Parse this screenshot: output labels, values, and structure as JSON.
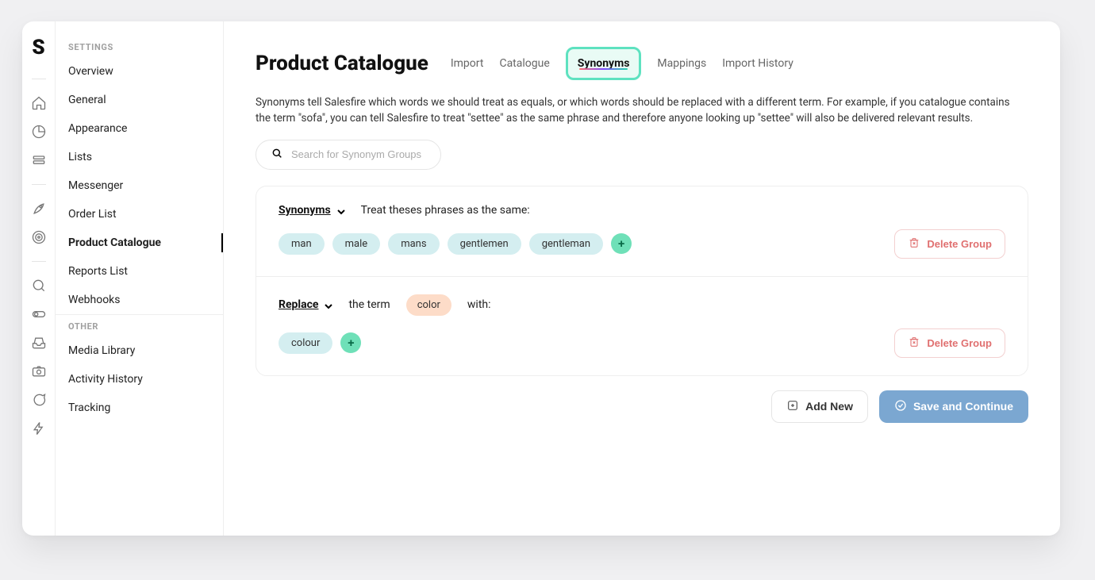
{
  "logo_letter": "S",
  "sidebar": {
    "section1_title": "SETTINGS",
    "section2_title": "OTHER",
    "items1": {
      "0": {
        "label": "Overview"
      },
      "1": {
        "label": "General"
      },
      "2": {
        "label": "Appearance"
      },
      "3": {
        "label": "Lists"
      },
      "4": {
        "label": "Messenger"
      },
      "5": {
        "label": "Order List"
      },
      "6": {
        "label": "Product Catalogue"
      },
      "7": {
        "label": "Reports List"
      },
      "8": {
        "label": "Webhooks"
      }
    },
    "items2": {
      "0": {
        "label": "Media Library"
      },
      "1": {
        "label": "Activity History"
      },
      "2": {
        "label": "Tracking"
      }
    }
  },
  "header": {
    "title": "Product Catalogue",
    "tabs": {
      "0": {
        "label": "Import"
      },
      "1": {
        "label": "Catalogue"
      },
      "2": {
        "label": "Synonyms"
      },
      "3": {
        "label": "Mappings"
      },
      "4": {
        "label": "Import History"
      }
    }
  },
  "description": "Synonyms tell Salesfire which words we should treat as equals, or which words should be replaced with a different term. For example, if you catalogue contains the term \"sofa\", you can tell Salesfire to treat \"settee\" as the same phrase and therefore anyone looking up \"settee\" will also be delivered relevant results.",
  "search": {
    "placeholder": "Search for Synonym Groups"
  },
  "groups": {
    "0": {
      "type_label": "Synonyms",
      "desc": "Treat theses phrases as the same:",
      "pills": {
        "0": "man",
        "1": "male",
        "2": "mans",
        "3": "gentlemen",
        "4": "gentleman"
      },
      "add_label": "+",
      "delete_label": "Delete Group"
    },
    "1": {
      "type_label": "Replace",
      "desc_prefix": "the term",
      "term": "color",
      "desc_suffix": "with:",
      "pills": {
        "0": "colour"
      },
      "add_label": "+",
      "delete_label": "Delete Group"
    }
  },
  "footer": {
    "add_label": "Add New",
    "save_label": "Save and Continue"
  }
}
